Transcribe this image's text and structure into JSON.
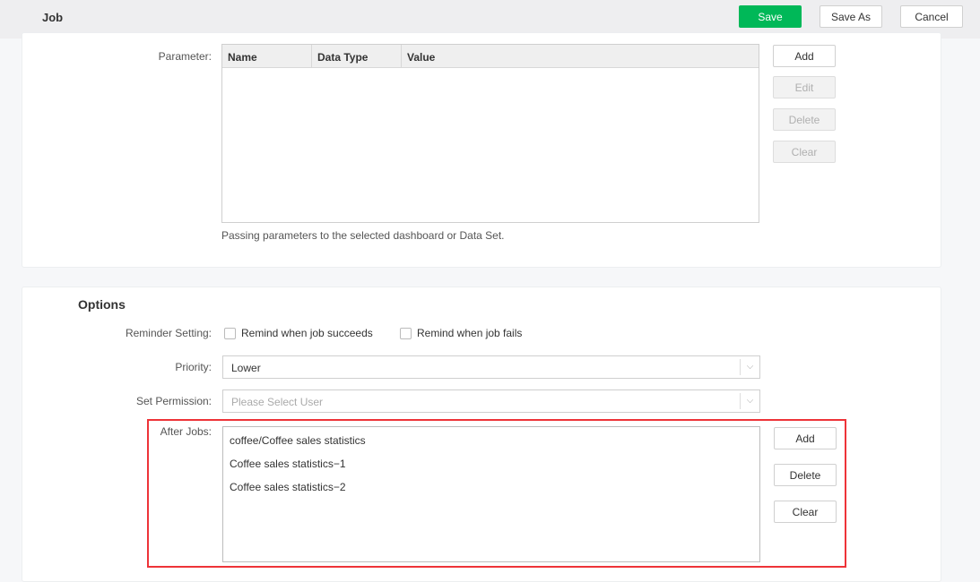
{
  "header": {
    "title": "Job",
    "save": "Save",
    "save_as": "Save As",
    "cancel": "Cancel"
  },
  "parameter": {
    "label": "Parameter:",
    "columns": [
      "Name",
      "Data Type",
      "Value"
    ],
    "rows": [],
    "buttons": {
      "add": "Add",
      "edit": "Edit",
      "delete": "Delete",
      "clear": "Clear"
    },
    "help": "Passing parameters to the selected dashboard or Data Set."
  },
  "options": {
    "title": "Options",
    "reminder": {
      "label": "Reminder Setting:",
      "succeeds": "Remind when job succeeds",
      "fails": "Remind when job fails"
    },
    "priority": {
      "label": "Priority:",
      "value": "Lower"
    },
    "permission": {
      "label": "Set Permission:",
      "placeholder": "Please Select User"
    },
    "after_jobs": {
      "label": "After Jobs:",
      "items": [
        "coffee/Coffee sales statistics",
        "Coffee sales statistics−1",
        "Coffee sales statistics−2"
      ],
      "buttons": {
        "add": "Add",
        "delete": "Delete",
        "clear": "Clear"
      }
    }
  },
  "colors": {
    "primary": "#00b858",
    "highlight": "#ee3338"
  }
}
